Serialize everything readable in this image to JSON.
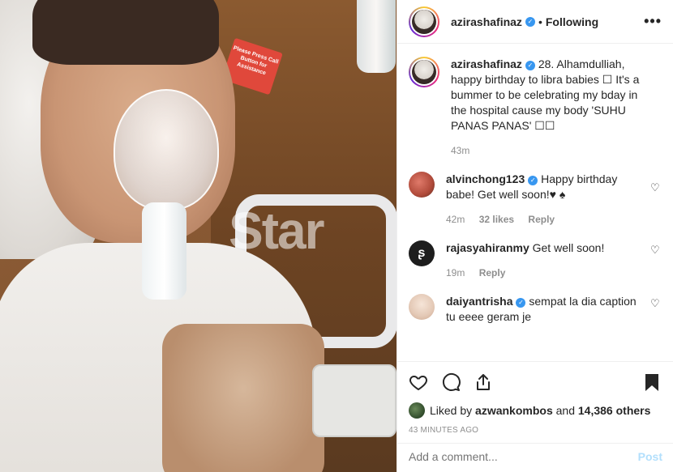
{
  "photo": {
    "sign_text": "Please Press Call Button for Assistance",
    "watermark": "Star"
  },
  "post": {
    "author": "azirashafinaz",
    "follow_status": "Following",
    "more_icon": "more-options-icon"
  },
  "caption": {
    "username": "azirashafinaz",
    "text": "28. Alhamdulliah, happy birthday to libra babies ☐ It's a bummer to be celebrating my bday in the hospital cause my body 'SUHU PANAS PANAS' ☐☐",
    "time": "43m"
  },
  "comments": [
    {
      "username": "alvinchong123",
      "text": "Happy birthday babe! Get well soon!♥ ♠",
      "time": "42m",
      "likes": "32 likes",
      "reply": "Reply"
    },
    {
      "username": "rajasyahiranmy",
      "text": "Get well soon!",
      "time": "19m",
      "reply": "Reply"
    },
    {
      "username": "daiyantrisha",
      "text": "sempat la dia caption tu eeee geram je"
    }
  ],
  "likes": {
    "liked_by_prefix": "Liked by",
    "liked_by_user": "azwankombos",
    "and_text": "and",
    "others": "14,386 others"
  },
  "timestamp": "43 MINUTES AGO",
  "add_comment": {
    "placeholder": "Add a comment...",
    "post_label": "Post"
  },
  "colors": {
    "verified": "#3897f0",
    "post_disabled": "#b2dffc",
    "muted": "#8e8e8e"
  }
}
